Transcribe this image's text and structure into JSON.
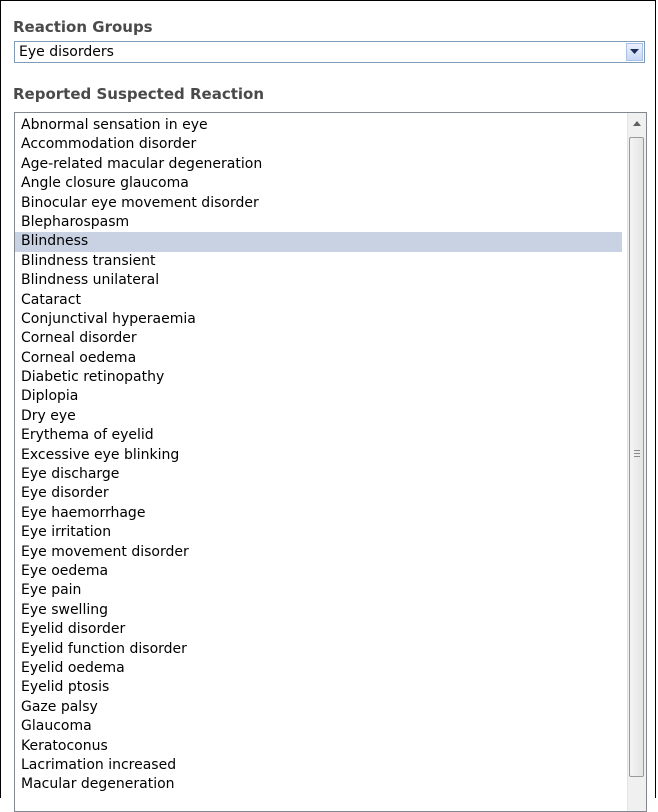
{
  "reaction_groups": {
    "label": "Reaction Groups",
    "selected_value": "Eye disorders",
    "dropdown_icon": "chevron-down-icon"
  },
  "reported_reaction": {
    "label": "Reported Suspected Reaction",
    "selected_item": "Blindness",
    "items": [
      "Abnormal sensation in eye",
      "Accommodation disorder",
      "Age-related macular degeneration",
      "Angle closure glaucoma",
      "Binocular eye movement disorder",
      "Blepharospasm",
      "Blindness",
      "Blindness transient",
      "Blindness unilateral",
      "Cataract",
      "Conjunctival hyperaemia",
      "Corneal disorder",
      "Corneal oedema",
      "Diabetic retinopathy",
      "Diplopia",
      "Dry eye",
      "Erythema of eyelid",
      "Excessive eye blinking",
      "Eye discharge",
      "Eye disorder",
      "Eye haemorrhage",
      "Eye irritation",
      "Eye movement disorder",
      "Eye oedema",
      "Eye pain",
      "Eye swelling",
      "Eyelid disorder",
      "Eyelid function disorder",
      "Eyelid oedema",
      "Eyelid ptosis",
      "Gaze palsy",
      "Glaucoma",
      "Keratoconus",
      "Lacrimation increased",
      "Macular degeneration"
    ]
  },
  "colors": {
    "label_text": "#4a4a4a",
    "selected_row": "#c8d2e3",
    "input_border": "#7f9db9"
  }
}
